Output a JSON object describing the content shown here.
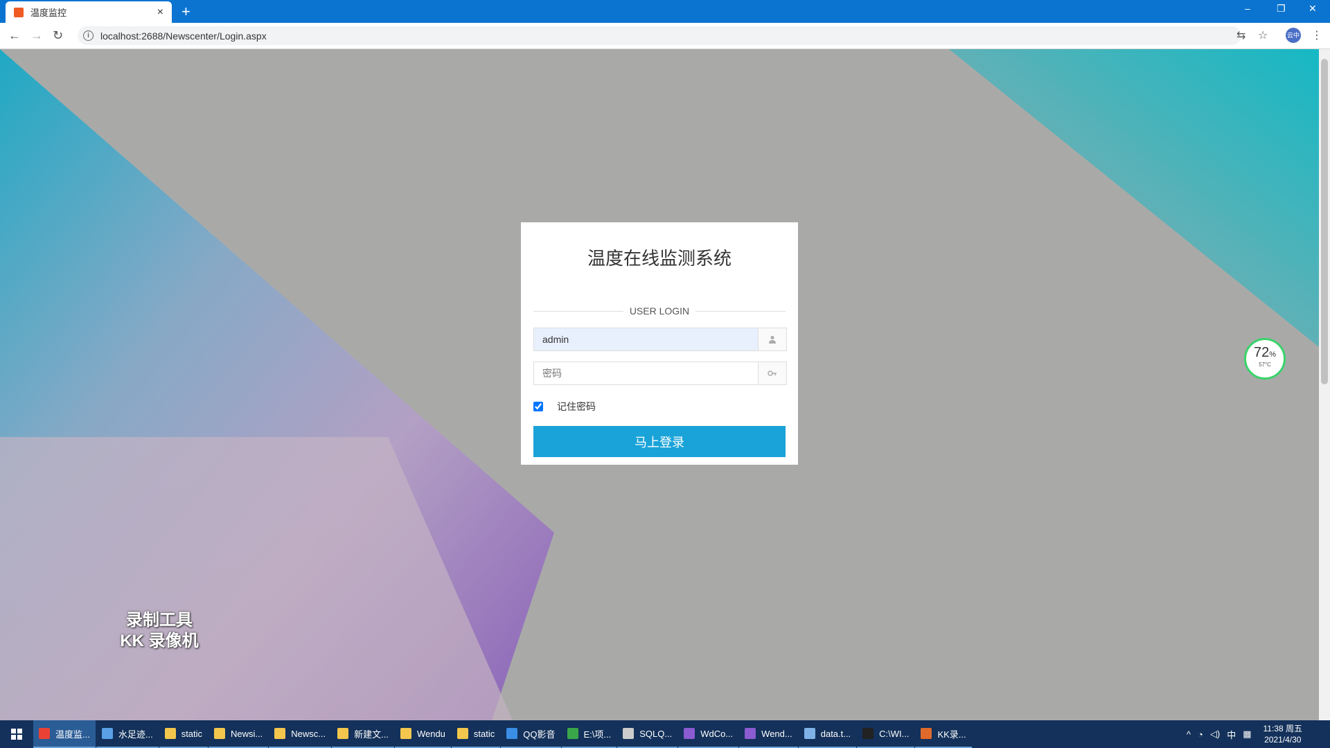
{
  "browser": {
    "tab_title": "温度监控",
    "tab_close": "×",
    "new_tab": "+",
    "url": "localhost:2688/Newscenter/Login.aspx",
    "profile_label": "云中",
    "window_controls": [
      "–",
      "❐",
      "✕"
    ]
  },
  "login": {
    "title": "温度在线监测系统",
    "subtitle": "USER LOGIN",
    "username_value": "admin",
    "password_placeholder": "密码",
    "remember_label": "记住密码",
    "remember_checked": true,
    "submit_label": "马上登录"
  },
  "gauge": {
    "percent": "72",
    "percent_unit": "%",
    "temperature": "57°C"
  },
  "watermark": {
    "line1": "录制工具",
    "line2": "KK 录像机"
  },
  "taskbar": {
    "items": [
      {
        "label": "温度监...",
        "color": "#e94235",
        "active": true
      },
      {
        "label": "水足迹...",
        "color": "#5aa0e6",
        "active": false
      },
      {
        "label": "static",
        "color": "#f3c74d",
        "active": false
      },
      {
        "label": "Newsi...",
        "color": "#f3c74d",
        "active": false
      },
      {
        "label": "Newsc...",
        "color": "#f3c74d",
        "active": false
      },
      {
        "label": "新建文...",
        "color": "#f3c74d",
        "active": false
      },
      {
        "label": "Wendu",
        "color": "#f3c74d",
        "active": false
      },
      {
        "label": "static",
        "color": "#f3c74d",
        "active": false
      },
      {
        "label": "QQ影音",
        "color": "#3a8ee6",
        "active": false
      },
      {
        "label": "E:\\项...",
        "color": "#3aa64a",
        "active": false
      },
      {
        "label": "SQLQ...",
        "color": "#cccccc",
        "active": false
      },
      {
        "label": "WdCo...",
        "color": "#8a5bd1",
        "active": false
      },
      {
        "label": "Wend...",
        "color": "#8a5bd1",
        "active": false
      },
      {
        "label": "data.t...",
        "color": "#7fb3e8",
        "active": false
      },
      {
        "label": "C:\\WI...",
        "color": "#222222",
        "active": false
      },
      {
        "label": "KK录...",
        "color": "#e06a2b",
        "active": false
      }
    ],
    "tray_ime": "中",
    "clock_time": "11:38 周五",
    "clock_date": "2021/4/30"
  }
}
